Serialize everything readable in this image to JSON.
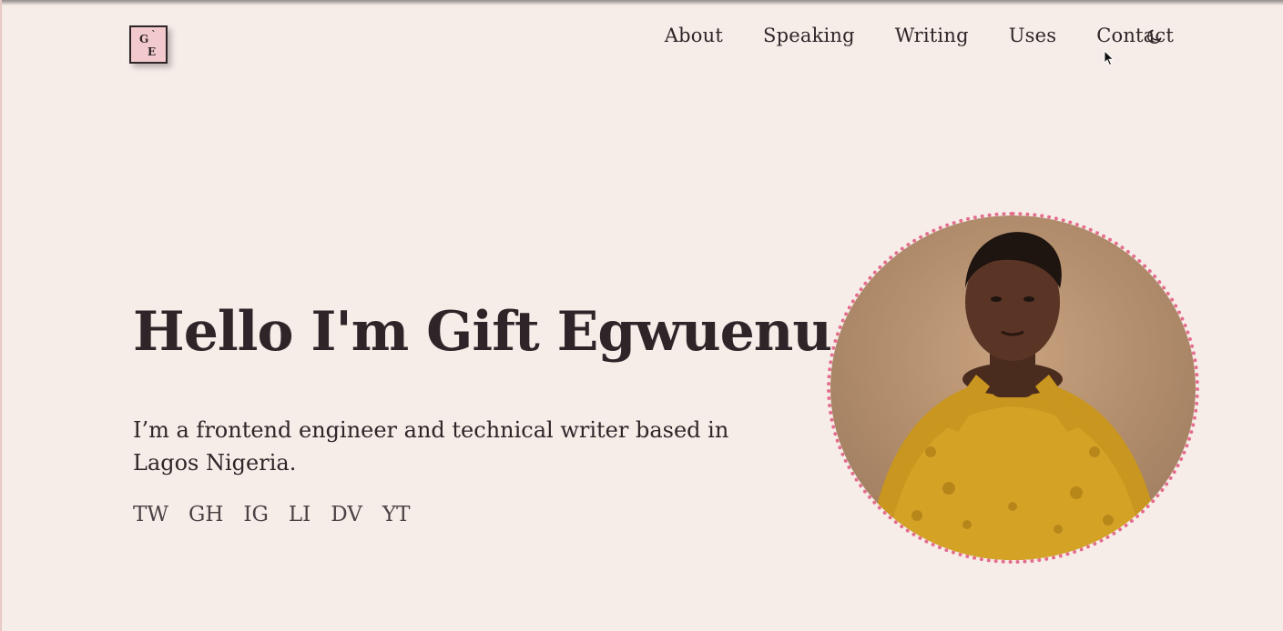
{
  "logo": {
    "letter_top": "G",
    "letter_bottom": "E",
    "accent": "`"
  },
  "nav": {
    "items": [
      {
        "label": "About"
      },
      {
        "label": "Speaking"
      },
      {
        "label": "Writing"
      },
      {
        "label": "Uses"
      },
      {
        "label": "Contact"
      }
    ],
    "theme_toggle_icon": "moon-icon"
  },
  "hero": {
    "title": "Hello I'm Gift Egwuenu",
    "subtitle": "I’m a frontend engineer and technical writer based in Lagos Nigeria.",
    "socials": [
      "TW",
      "GH",
      "IG",
      "LI",
      "DV",
      "YT"
    ]
  },
  "colors": {
    "background": "#f6ede8",
    "text": "#2e2529",
    "logo_bg": "#f2c9cc",
    "photo_ring": "#e56d8c"
  }
}
